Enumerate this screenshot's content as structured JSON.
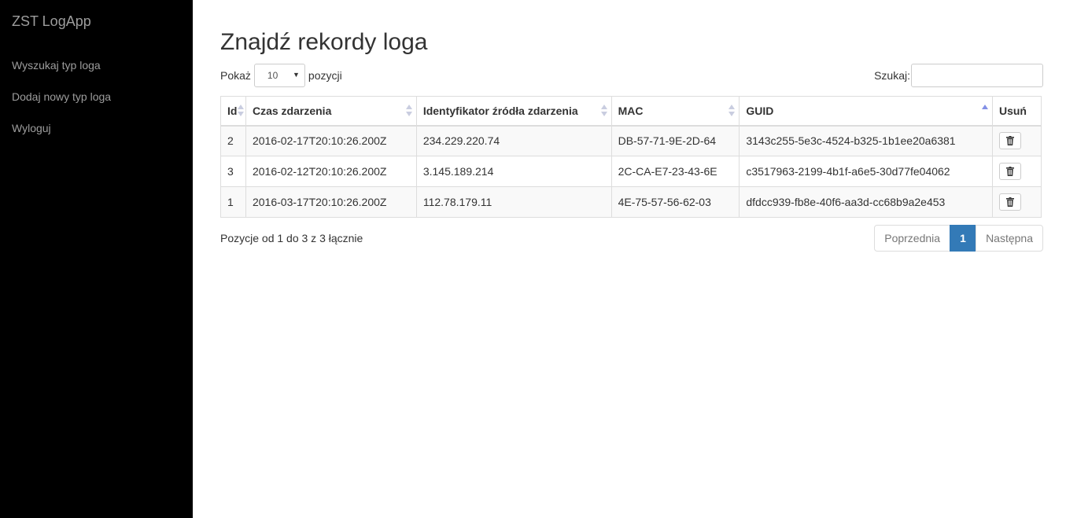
{
  "sidebar": {
    "brand": "ZST LogApp",
    "items": [
      {
        "label": "Wyszukaj typ loga"
      },
      {
        "label": "Dodaj nowy typ loga"
      },
      {
        "label": "Wyloguj"
      }
    ]
  },
  "main": {
    "title": "Znajdź rekordy loga",
    "length": {
      "prefix": "Pokaż",
      "value": "10",
      "suffix": "pozycji"
    },
    "search": {
      "label": "Szukaj:",
      "value": ""
    },
    "columns": [
      {
        "label": "Id",
        "sort": "none"
      },
      {
        "label": "Czas zdarzenia",
        "sort": "none"
      },
      {
        "label": "Identyfikator źródła zdarzenia",
        "sort": "none"
      },
      {
        "label": "MAC",
        "sort": "none"
      },
      {
        "label": "GUID",
        "sort": "asc"
      },
      {
        "label": "Usuń"
      }
    ],
    "rows": [
      {
        "id": "2",
        "time": "2016-02-17T20:10:26.200Z",
        "source": "234.229.220.74",
        "mac": "DB-57-71-9E-2D-64",
        "guid": "3143c255-5e3c-4524-b325-1b1ee20a6381"
      },
      {
        "id": "3",
        "time": "2016-02-12T20:10:26.200Z",
        "source": "3.145.189.214",
        "mac": "2C-CA-E7-23-43-6E",
        "guid": "c3517963-2199-4b1f-a6e5-30d77fe04062"
      },
      {
        "id": "1",
        "time": "2016-03-17T20:10:26.200Z",
        "source": "112.78.179.11",
        "mac": "4E-75-57-56-62-03",
        "guid": "dfdcc939-fb8e-40f6-aa3d-cc68b9a2e453"
      }
    ],
    "info": "Pozycje od 1 do 3 z 3 łącznie",
    "pagination": {
      "prev": "Poprzednia",
      "current": "1",
      "next": "Następna"
    }
  },
  "icons": {
    "delete": "trash-icon",
    "select": "caret-down-icon"
  },
  "colors": {
    "sidebar_bg": "#000000",
    "accent": "#337ab7",
    "sort_active": "#8390e6"
  }
}
